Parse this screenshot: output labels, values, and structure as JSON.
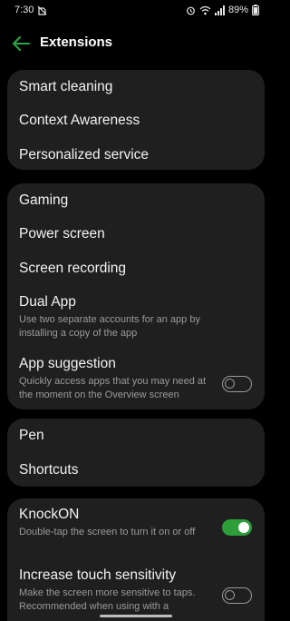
{
  "status_bar": {
    "time": "7:30",
    "battery": "89%",
    "icons": [
      "no-notification-icon",
      "alarm-icon",
      "wifi-icon",
      "signal-icon",
      "battery-icon"
    ]
  },
  "header": {
    "title": "Extensions",
    "accent": "#27a745"
  },
  "group1": {
    "items": [
      {
        "label": "Smart cleaning"
      },
      {
        "label": "Context Awareness"
      },
      {
        "label": "Personalized service"
      }
    ]
  },
  "group2": {
    "items": [
      {
        "label": "Gaming"
      },
      {
        "label": "Power screen"
      },
      {
        "label": "Screen recording"
      },
      {
        "label": "Dual App",
        "sub": "Use two separate accounts for an app by installing a copy of the app"
      },
      {
        "label": "App suggestion",
        "sub": "Quickly access apps that you may need at the moment on the Overview screen",
        "toggle": "off"
      }
    ]
  },
  "group3": {
    "items": [
      {
        "label": "Pen"
      },
      {
        "label": "Shortcuts"
      }
    ]
  },
  "group4": {
    "items": [
      {
        "label": "KnockON",
        "sub": "Double-tap the screen to turn it on or off",
        "toggle": "on"
      },
      {
        "label": "Increase touch sensitivity",
        "sub": "Make the screen more sensitive to taps. Recommended when using with a",
        "toggle": "off"
      }
    ]
  },
  "colors": {
    "background": "#000000",
    "card": "#1f1f1f",
    "toggle_on": "#2e9e3a"
  }
}
